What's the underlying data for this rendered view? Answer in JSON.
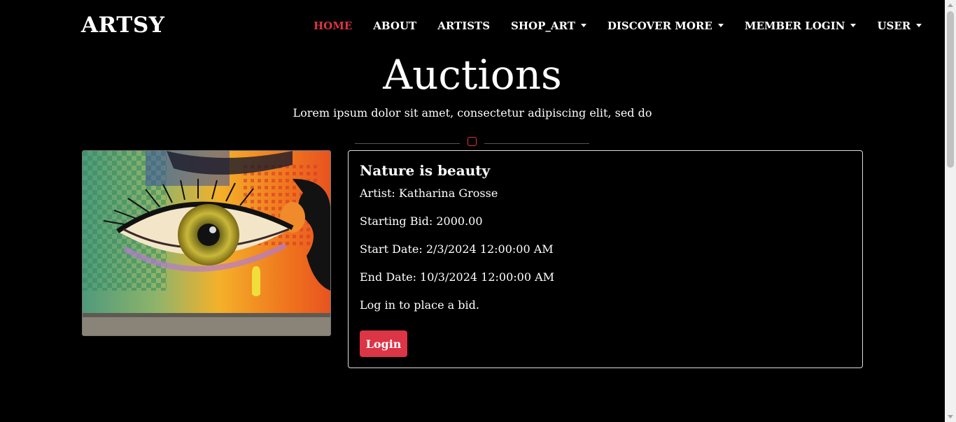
{
  "brand": "ARTSY",
  "nav": {
    "home": "HOME",
    "about": "ABOUT",
    "artists": "ARTISTS",
    "shop_art": "SHOP_ART",
    "discover_more": "DISCOVER MORE",
    "member_login": "MEMBER LOGIN",
    "user": "USER"
  },
  "header": {
    "title": "Auctions",
    "subtitle": "Lorem ipsum dolor sit amet, consectetur adipiscing elit, sed do"
  },
  "auction": {
    "image_icon": "artwork-eye-mural",
    "title": "Nature is beauty",
    "artist": "Artist: Katharina Grosse",
    "starting_bid": "Starting Bid: 2000.00",
    "start_date": "Start Date: 2/3/2024 12:00:00 AM",
    "end_date": "End Date: 10/3/2024 12:00:00 AM",
    "note": "Log in to place a bid.",
    "login_label": "Login"
  },
  "colors": {
    "accent": "#dc3545",
    "background": "#000000",
    "text": "#ffffff"
  }
}
